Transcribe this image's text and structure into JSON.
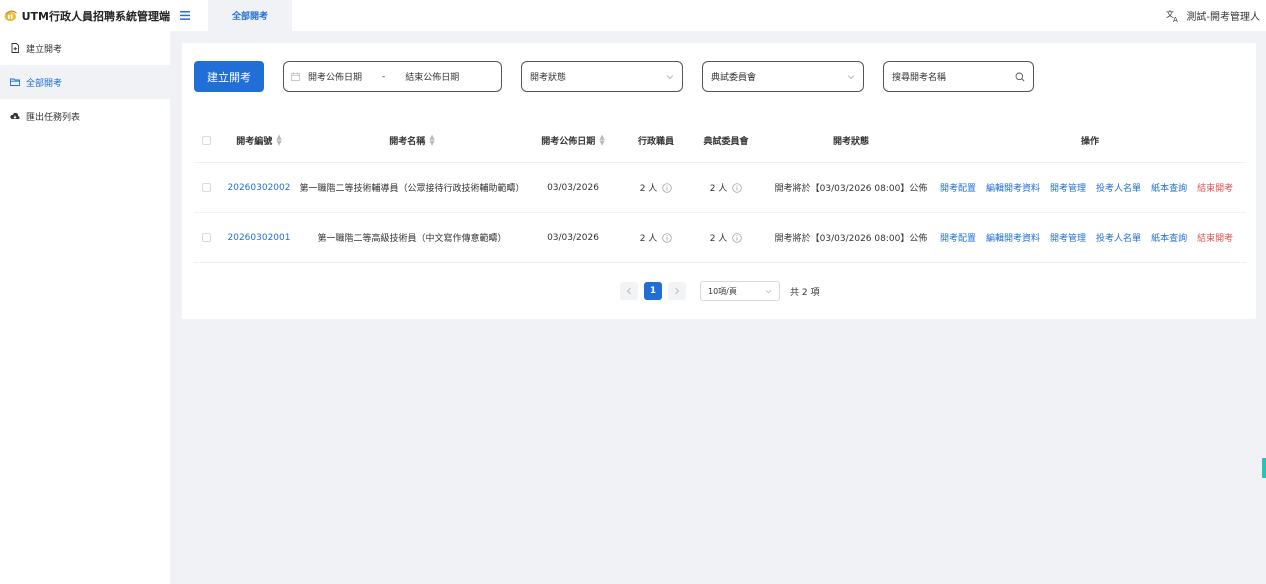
{
  "app": {
    "title": "UTM行政人員招聘系統管理端"
  },
  "top_tab": {
    "label": "全部開考"
  },
  "user": {
    "name": "測試-開考管理人"
  },
  "sidebar": {
    "items": [
      {
        "label": "建立開考",
        "icon": "document-add-icon",
        "active": false
      },
      {
        "label": "全部開考",
        "icon": "folder-icon",
        "active": true
      },
      {
        "label": "匯出任務列表",
        "icon": "cloud-download-icon",
        "active": false
      }
    ]
  },
  "filters": {
    "create_label": "建立開考",
    "date_start_placeholder": "開考公佈日期",
    "date_sep": "-",
    "date_end_placeholder": "結束公佈日期",
    "status_placeholder": "開考狀態",
    "committee_placeholder": "典試委員會",
    "search_placeholder": "搜尋開考名稱"
  },
  "table": {
    "headers": {
      "code": "開考編號",
      "name": "開考名稱",
      "date": "開考公佈日期",
      "admin": "行政職員",
      "committee": "典試委員會",
      "status": "開考狀態",
      "ops": "操作"
    },
    "rows": [
      {
        "code": "20260302002",
        "name": "第一職階二等技術輔導員（公眾接待行政技術輔助範疇）",
        "date": "03/03/2026",
        "admin": "2 人",
        "committee": "2 人",
        "status": "開考將於【03/03/2026 08:00】公佈"
      },
      {
        "code": "20260302001",
        "name": "第一職階二等高級技術員（中文寫作傳意範疇）",
        "date": "03/03/2026",
        "admin": "2 人",
        "committee": "2 人",
        "status": "開考將於【03/03/2026 08:00】公佈"
      }
    ],
    "actions": {
      "config": "開考配置",
      "edit": "編輯開考資料",
      "manage": "開考管理",
      "applicants": "投考人名單",
      "paper_query": "紙本查詢",
      "end": "結束開考"
    }
  },
  "pagination": {
    "current": "1",
    "page_size": "10項/頁",
    "total": "共 2 項"
  },
  "colors": {
    "primary": "#1f6fd6",
    "danger": "#e05050",
    "accent_marker": "#2bc4b4"
  }
}
